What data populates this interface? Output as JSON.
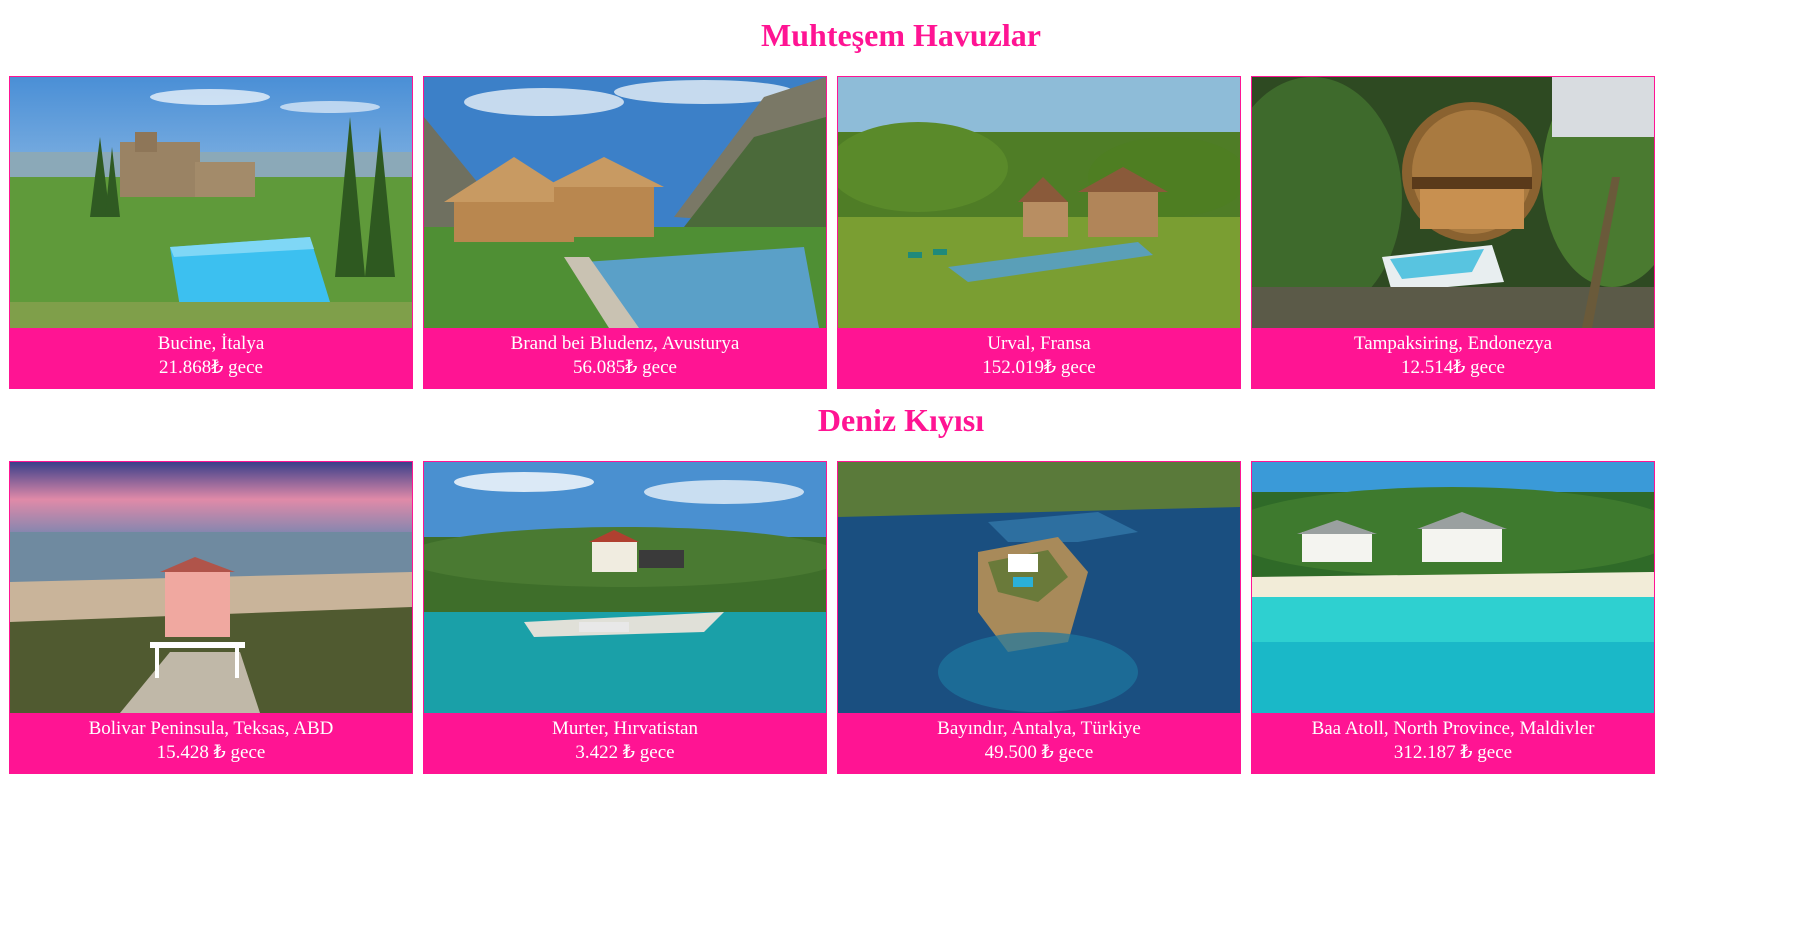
{
  "sections": [
    {
      "title": "Muhteşem Havuzlar",
      "cards": [
        {
          "location": "Bucine, İtalya",
          "price": "21.868₺ gece",
          "image": "tuscan-villa-with-pool-photo"
        },
        {
          "location": "Brand bei Bludenz, Avusturya",
          "price": "56.085₺ gece",
          "image": "alpine-chalet-with-pool-photo"
        },
        {
          "location": "Urval, Fransa",
          "price": "152.019₺ gece",
          "image": "stone-farmhouse-with-lap-pool-photo"
        },
        {
          "location": "Tampaksiring, Endonezya",
          "price": "12.514₺ gece",
          "image": "bamboo-dome-house-with-pool-photo"
        }
      ]
    },
    {
      "title": "Deniz Kıyısı",
      "cards": [
        {
          "location": "Bolivar Peninsula, Teksas, ABD",
          "price": "15.428 ₺ gece",
          "image": "pink-beach-house-photo"
        },
        {
          "location": "Murter, Hırvatistan",
          "price": "3.422 ₺ gece",
          "image": "seaside-house-with-dock-photo"
        },
        {
          "location": "Bayındır, Antalya, Türkiye",
          "price": "49.500 ₺ gece",
          "image": "peninsula-villa-aerial-photo"
        },
        {
          "location": "Baa Atoll, North Province, Maldivler",
          "price": "312.187 ₺ gece",
          "image": "tropical-beach-villas-photo"
        }
      ]
    }
  ],
  "colors": {
    "accent": "#ff1493",
    "caption_text": "#ffffff"
  }
}
